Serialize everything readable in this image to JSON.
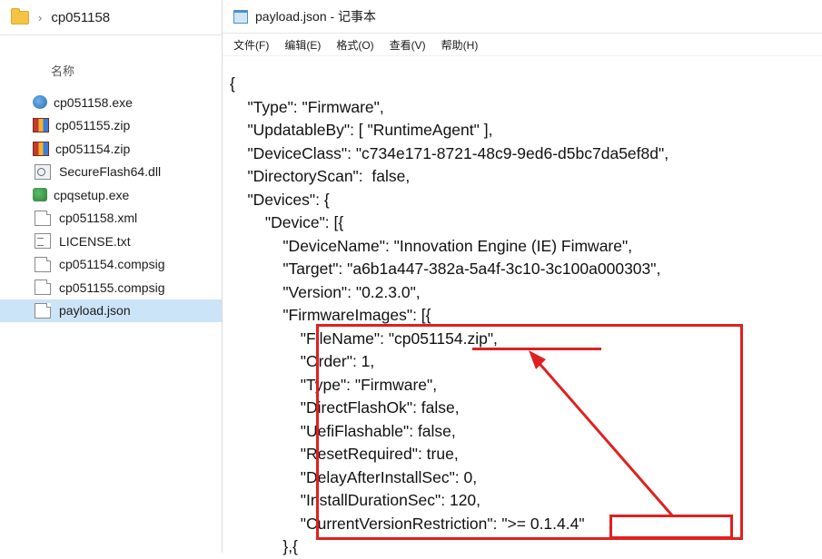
{
  "explorer": {
    "breadcrumb": "cp051158",
    "column_header": "名称",
    "files": [
      {
        "name": "cp051158.exe",
        "icon": "exe-icon"
      },
      {
        "name": "cp051155.zip",
        "icon": "zip-icon"
      },
      {
        "name": "cp051154.zip",
        "icon": "zip-icon"
      },
      {
        "name": "SecureFlash64.dll",
        "icon": "dll-icon"
      },
      {
        "name": "cpqsetup.exe",
        "icon": "setup-icon"
      },
      {
        "name": "cp051158.xml",
        "icon": "document-icon"
      },
      {
        "name": "LICENSE.txt",
        "icon": "text-file-icon"
      },
      {
        "name": "cp051154.compsig",
        "icon": "document-icon"
      },
      {
        "name": "cp051155.compsig",
        "icon": "document-icon"
      },
      {
        "name": "payload.json",
        "icon": "document-icon",
        "selected": true
      }
    ]
  },
  "notepad": {
    "title": "payload.json - 记事本",
    "menu": [
      "文件(F)",
      "编辑(E)",
      "格式(O)",
      "查看(V)",
      "帮助(H)"
    ],
    "lines": [
      "{",
      "    \"Type\": \"Firmware\",",
      "    \"UpdatableBy\": [ \"RuntimeAgent\" ],",
      "    \"DeviceClass\": \"c734e171-8721-48c9-9ed6-d5bc7da5ef8d\",",
      "    \"DirectoryScan\":  false,",
      "    \"Devices\": {",
      "        \"Device\": [{",
      "            \"DeviceName\": \"Innovation Engine (IE) Fimware\",",
      "            \"Target\": \"a6b1a447-382a-5a4f-3c10-3c100a000303\",",
      "            \"Version\": \"0.2.3.0\",",
      "            \"FirmwareImages\": [{",
      "                \"FileName\": \"cp051154.zip\",",
      "                \"Order\": 1,",
      "                \"Type\": \"Firmware\",",
      "                \"DirectFlashOk\": false,",
      "                \"UefiFlashable\": false,",
      "                \"ResetRequired\": true,",
      "                \"DelayAfterInstallSec\": 0,",
      "                \"InstallDurationSec\": 120,",
      "                \"CurrentVersionRestriction\": \">= 0.1.4.4\"",
      "            },{"
    ]
  },
  "colors": {
    "annotation_red": "#e0201f",
    "selection_blue": "#cce4f7"
  }
}
